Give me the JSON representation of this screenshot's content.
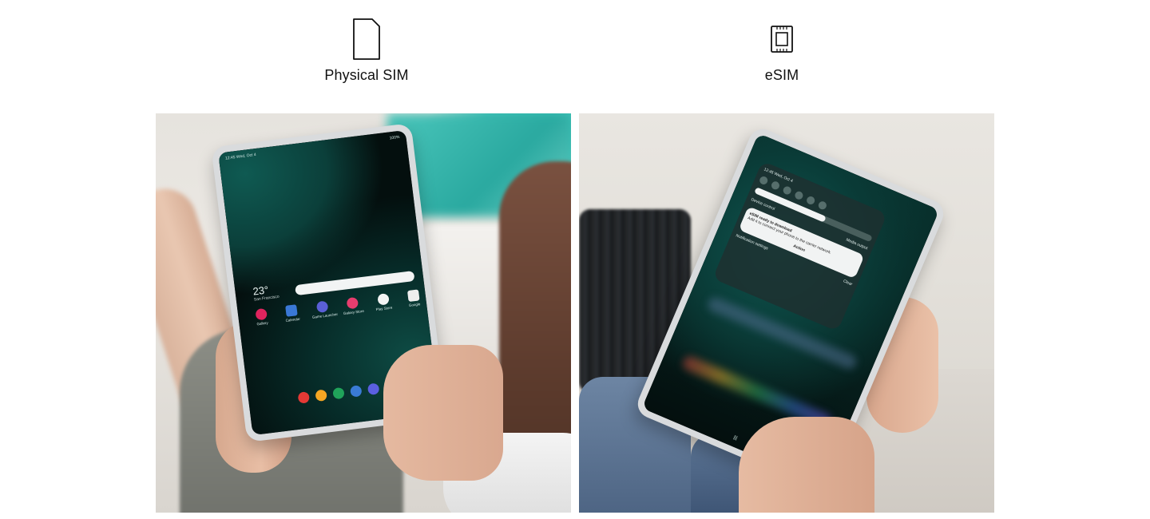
{
  "headers": {
    "physical": {
      "label": "Physical SIM",
      "icon": "sim-card-icon"
    },
    "esim": {
      "label": "eSIM",
      "icon": "esim-chip-icon"
    }
  },
  "left_tablet": {
    "status_time": "12:45 Wed, Oct 4",
    "status_battery": "100%",
    "weather_temp": "23°",
    "weather_city": "San Francisco",
    "apps": [
      {
        "label": "Gallery",
        "color": "#e0245e"
      },
      {
        "label": "Calendar",
        "color": "#3a78d6"
      },
      {
        "label": "Game Launcher",
        "color": "#5a5fd6"
      },
      {
        "label": "Galaxy Store",
        "color": "#e83d6e"
      },
      {
        "label": "Play Store",
        "color": "#f4f4f4"
      },
      {
        "label": "Google",
        "color": "#eeeeee"
      }
    ],
    "dock_colors": [
      "#e53935",
      "#f5a623",
      "#20a35a",
      "#3a7bd5",
      "#5b5fe0",
      "#e5396f"
    ]
  },
  "right_tablet": {
    "status_time": "12:45 Wed, Oct 4",
    "panel_time": "12:45 Wed, Oct 4",
    "device_control": "Device control",
    "media_output": "Media output",
    "notif_title": "eSIM ready to download",
    "notif_body": "Add it to connect your phone to the carrier network.",
    "notif_action": "Action",
    "notif_clear": "Clear",
    "notif_settings": "Notification settings"
  }
}
